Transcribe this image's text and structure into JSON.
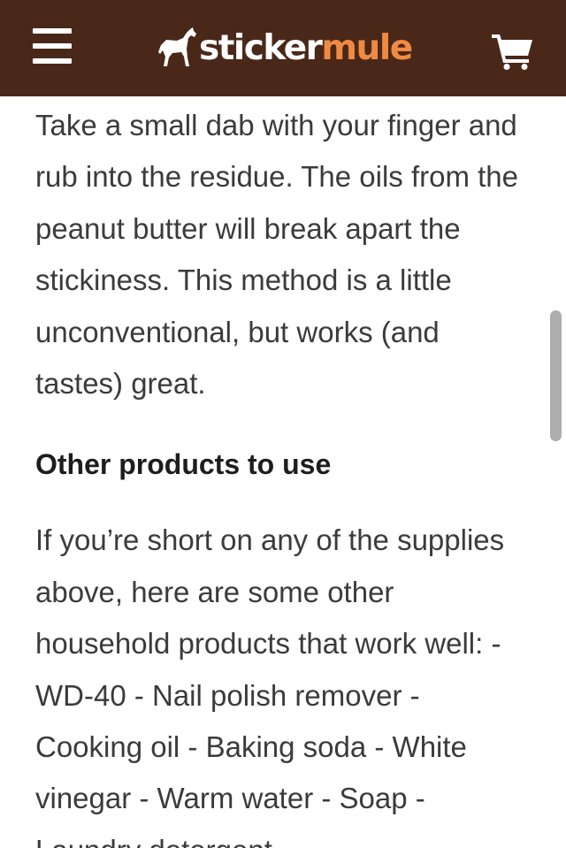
{
  "header": {
    "brand_part1": "sticker",
    "brand_part2": "mule",
    "menu_icon": "hamburger-menu-icon",
    "cart_icon": "shopping-cart-icon",
    "background_color": "#4a2819",
    "accent_color": "#f08a42"
  },
  "article": {
    "paragraph_1": "Take a small dab with your finger and rub into the residue. The oils from the peanut butter will break apart the stickiness. This method is a little unconventional, but works (and tastes) great.",
    "heading": "Other products to use",
    "paragraph_2": "If you’re short on any of the supplies above, here are some other household products that work well: - WD-40 - Nail polish remover - Cooking oil - Baking soda - White vinegar - Warm water - Soap - Laundry detergent"
  }
}
